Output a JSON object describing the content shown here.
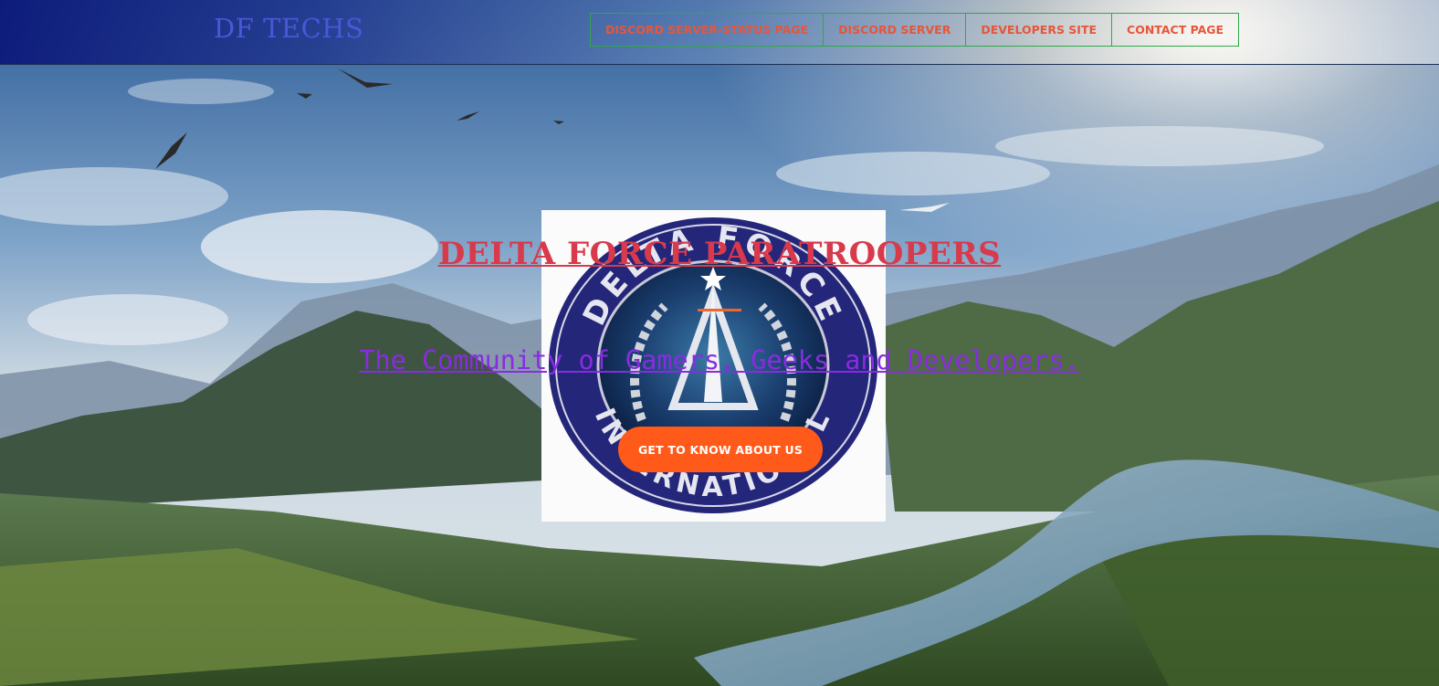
{
  "header": {
    "brand": "DF TECHS",
    "nav": [
      {
        "label": "DISCORD SERVER-STATUS PAGE"
      },
      {
        "label": "DISCORD SERVER"
      },
      {
        "label": "DEVELOPERS SITE"
      },
      {
        "label": "CONTACT PAGE"
      }
    ]
  },
  "hero": {
    "title": "DELTA FORCE PARATROOPERS",
    "subtitle": "The Community of Gamers, Geeks and Developers.",
    "cta_label": "GET TO KNOW ABOUT US"
  },
  "logo": {
    "text_top": "DELTA FORCE",
    "text_bottom": "INTERNATIONAL"
  },
  "colors": {
    "brand": "#4b57d9",
    "nav_text": "#e8553a",
    "nav_border": "#2fa84a",
    "title": "#d83a4c",
    "subtitle": "#8a2be2",
    "cta": "#ff5a1a"
  }
}
